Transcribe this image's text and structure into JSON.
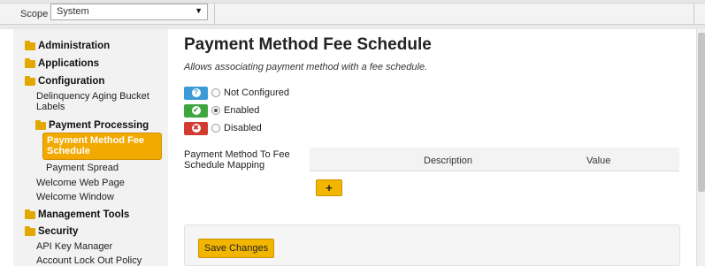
{
  "scope": {
    "label": "Scope",
    "value": "System"
  },
  "sidebar": {
    "administration": "Administration",
    "applications": "Applications",
    "configuration": "Configuration",
    "delinquency": "Delinquency Aging Bucket Labels",
    "payment_processing": "Payment Processing",
    "payment_method_fee_schedule": "Payment Method Fee Schedule",
    "payment_spread": "Payment Spread",
    "welcome_web_page": "Welcome Web Page",
    "welcome_window": "Welcome Window",
    "management_tools": "Management Tools",
    "security": "Security",
    "api_key_manager": "API Key Manager",
    "account_lock_out_policy": "Account Lock Out Policy"
  },
  "main": {
    "title": "Payment Method Fee Schedule",
    "subtitle": "Allows associating payment method with a fee schedule.",
    "legend": [
      {
        "label": "Not Configured",
        "symbol": "?",
        "color": "#3c9bd6",
        "checked": false
      },
      {
        "label": "Enabled",
        "symbol": "✔",
        "color": "#3fa63f",
        "checked": true
      },
      {
        "label": "Disabled",
        "symbol": "✖",
        "color": "#d23b30",
        "checked": false
      }
    ],
    "mapping_label": "Payment Method To Fee Schedule Mapping",
    "table_headers": {
      "description": "Description",
      "value": "Value"
    },
    "add_label": "+",
    "save_label": "Save Changes"
  }
}
